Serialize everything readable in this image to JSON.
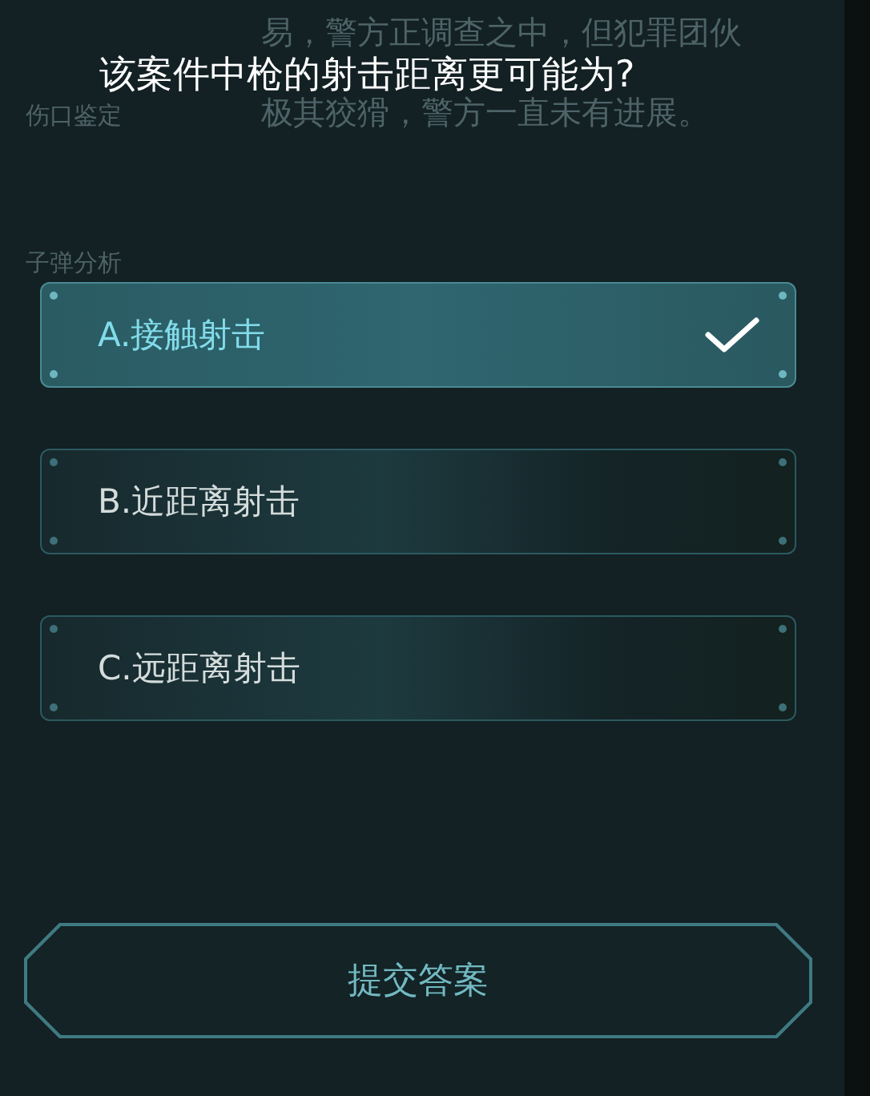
{
  "background_text": {
    "story_lines": [
      "易，警方正调查之中，但犯罪团伙",
      "极其狡猾，警方一直未有进展。"
    ],
    "section_labels": [
      "伤口鉴定",
      "子弹分析"
    ]
  },
  "question": "该案件中枪的射击距离更可能为?",
  "options": [
    {
      "label": "A.接触射击",
      "selected": true
    },
    {
      "label": "B.近距离射击",
      "selected": false
    },
    {
      "label": "C.远距离射击",
      "selected": false
    }
  ],
  "submit_button": "提交答案"
}
